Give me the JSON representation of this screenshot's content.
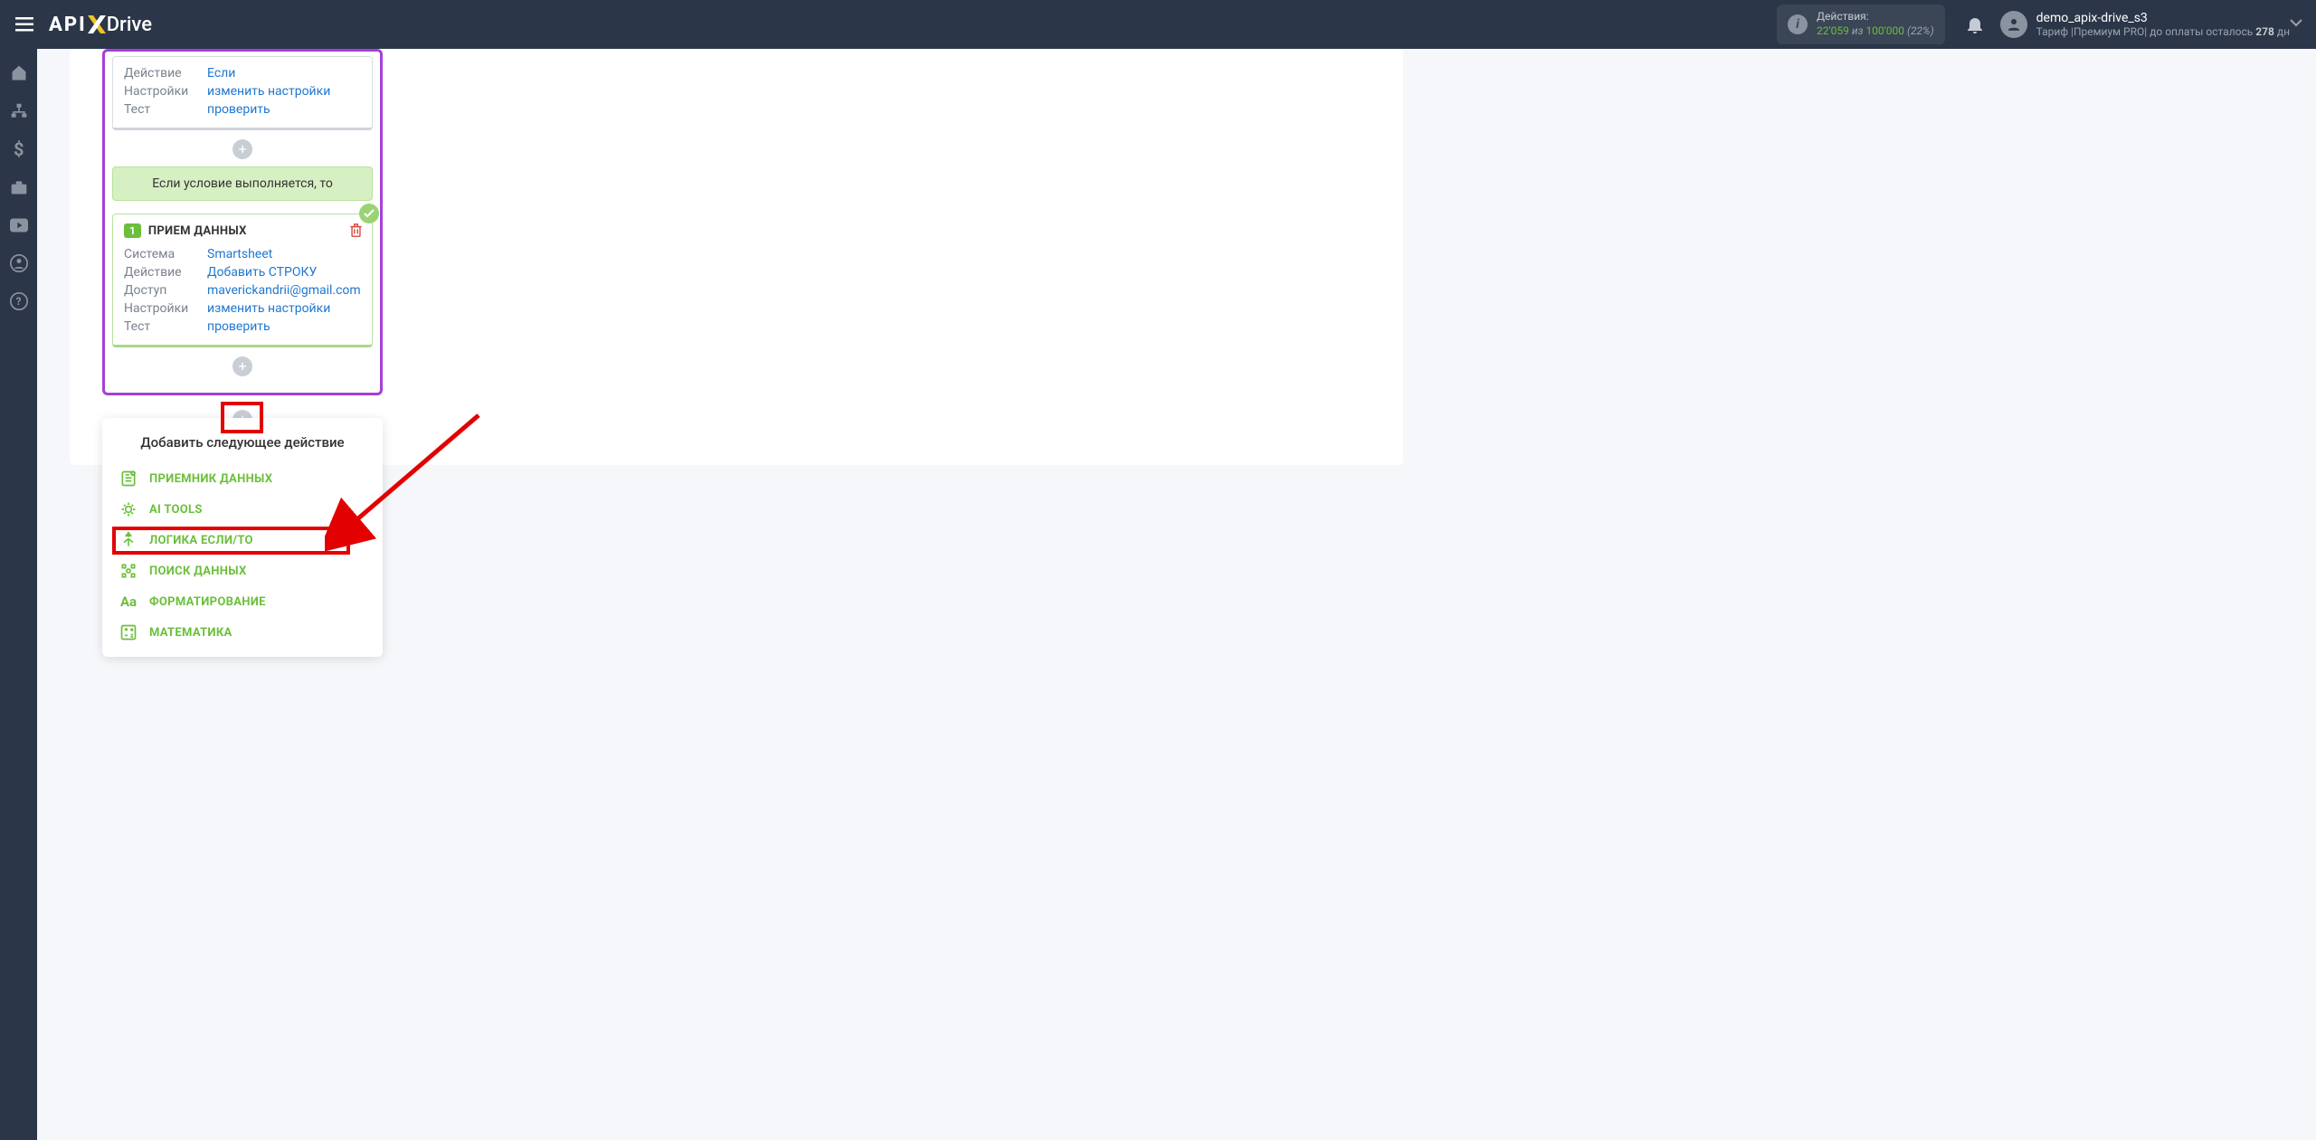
{
  "header": {
    "logo_api": "API",
    "logo_drive": "Drive",
    "actions_label": "Действия:",
    "actions_used": "22'059",
    "actions_sep": "из",
    "actions_total": "100'000",
    "actions_pct": "(22%)",
    "username": "demo_apix-drive_s3",
    "plan_prefix": "Тариф |",
    "plan_name": "Премиум PRO",
    "plan_sep": "| до оплаты осталось ",
    "plan_days": "278",
    "plan_days_unit": " дн"
  },
  "card1": {
    "k_action": "Действие",
    "v_action": "Если",
    "k_settings": "Настройки",
    "v_settings": "изменить настройки",
    "k_test": "Тест",
    "v_test": "проверить"
  },
  "cond_text": "Если условие выполняется, то",
  "card2": {
    "step_num": "1",
    "title": "ПРИЕМ ДАННЫХ",
    "k_system": "Система",
    "v_system": "Smartsheet",
    "k_action": "Действие",
    "v_action": "Добавить СТРОКУ",
    "k_access": "Доступ",
    "v_access": "maverickandrii@gmail.com",
    "k_settings": "Настройки",
    "v_settings": "изменить настройки",
    "k_test": "Тест",
    "v_test": "проверить"
  },
  "dropdown": {
    "title": "Добавить следующее действие",
    "items": [
      {
        "icon": "receiver-icon",
        "label": "ПРИЕМНИК ДАННЫХ"
      },
      {
        "icon": "ai-tools-icon",
        "label": "AI TOOLS"
      },
      {
        "icon": "logic-icon",
        "label": "ЛОГИКА ЕСЛИ/ТО"
      },
      {
        "icon": "search-data-icon",
        "label": "ПОИСК ДАННЫХ"
      },
      {
        "icon": "format-icon",
        "label": "ФОРМАТИРОВАНИЕ"
      },
      {
        "icon": "math-icon",
        "label": "МАТЕМАТИКА"
      }
    ]
  }
}
